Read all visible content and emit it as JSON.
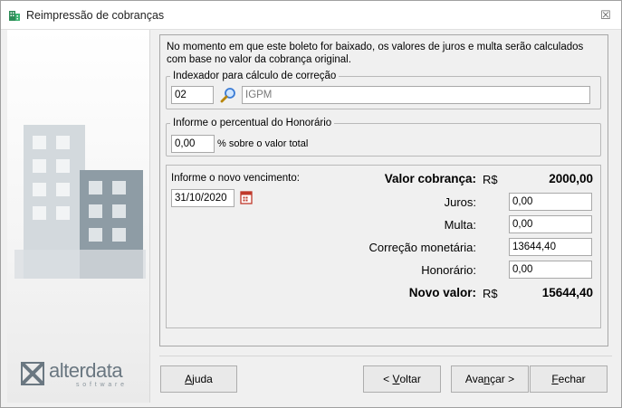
{
  "window": {
    "title": "Reimpressão de cobranças",
    "close_glyph": "☒"
  },
  "brand": {
    "logo_text": "alterdata",
    "logo_sub": "software"
  },
  "intro_text": "No momento em que este boleto for baixado, os valores de juros e multa serão calculados com base no valor da cobrança original.",
  "indexador": {
    "legend": "Indexador para cálculo de correção",
    "code": "02",
    "name": "IGPM"
  },
  "honorario": {
    "legend": "Informe o percentual do Honorário",
    "percent": "0,00",
    "suffix": "% sobre o valor total"
  },
  "vencimento": {
    "label": "Informe o novo vencimento:",
    "date": "31/10/2020"
  },
  "valores": {
    "valor_cobranca_label": "Valor cobrança:",
    "currency": "R$",
    "valor_cobranca": "2000,00",
    "juros_label": "Juros:",
    "juros": "0,00",
    "multa_label": "Multa:",
    "multa": "0,00",
    "correcao_label": "Correção monetária:",
    "correcao": "13644,40",
    "honorario_label": "Honorário:",
    "honorario": "0,00",
    "novo_valor_label": "Novo valor:",
    "novo_valor": "15644,40"
  },
  "buttons": {
    "ajuda_u": "A",
    "ajuda_rest": "juda",
    "voltar_pre": "< ",
    "voltar_u": "V",
    "voltar_rest": "oltar",
    "avancar_pre": "Ava",
    "avancar_u": "n",
    "avancar_rest": "çar >",
    "fechar_u": "F",
    "fechar_rest": "echar"
  },
  "colors": {
    "building_light": "#d3d9dd",
    "building_dark": "#8e9ca5",
    "calendar_red": "#c0392b",
    "search_blue": "#3a7bd5"
  }
}
